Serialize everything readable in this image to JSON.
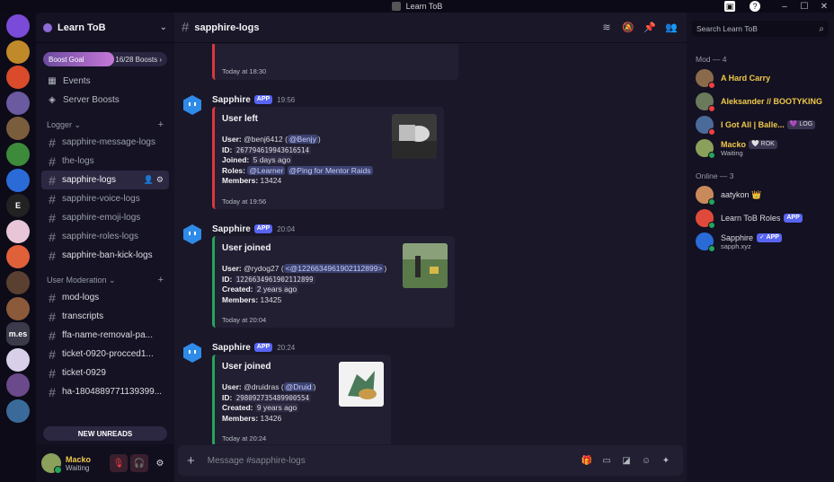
{
  "window": {
    "title": "Learn ToB",
    "controls": [
      "–",
      "☐",
      "✕"
    ]
  },
  "servers": [
    {
      "label": "",
      "color": "#7a4bd8"
    },
    {
      "label": "",
      "color": "#c08a2a"
    },
    {
      "label": "",
      "color": "#d94b2a"
    },
    {
      "label": "",
      "color": "#6b5aa0"
    },
    {
      "label": "",
      "color": "#7a5d3c"
    },
    {
      "label": "",
      "color": "#3d8a3a"
    },
    {
      "label": "",
      "color": "#2a6bd8"
    },
    {
      "label": "E",
      "color": "#222222"
    },
    {
      "label": "",
      "color": "#e8c6d8"
    },
    {
      "label": "",
      "color": "#e0603a"
    },
    {
      "label": "",
      "color": "#5a4030"
    },
    {
      "label": "",
      "color": "#8a5a3a"
    },
    {
      "label": "m.es",
      "color": "#3a3a4a"
    },
    {
      "label": "",
      "color": "#d8d0e8"
    },
    {
      "label": "",
      "color": "#6a4a8a"
    },
    {
      "label": "",
      "color": "#3a6a9a"
    }
  ],
  "guild": {
    "name": "Learn ToB",
    "boost": {
      "goal_label": "Boost Goal",
      "progress_text": "16/28 Boosts",
      "arrow": "›",
      "fraction": 0.571
    }
  },
  "nav": [
    {
      "label": "Events",
      "icon": "calendar-icon",
      "glyph": "▦"
    },
    {
      "label": "Server Boosts",
      "icon": "boost-icon",
      "glyph": "◈"
    }
  ],
  "categories": [
    {
      "name": "Logger",
      "chevron": "⌄",
      "channels": [
        {
          "label": "sapphire-message-logs",
          "state": "normal"
        },
        {
          "label": "the-logs",
          "state": "normal"
        },
        {
          "label": "sapphire-logs",
          "state": "active"
        },
        {
          "label": "sapphire-voice-logs",
          "state": "normal"
        },
        {
          "label": "sapphire-emoji-logs",
          "state": "normal"
        },
        {
          "label": "sapphire-roles-logs",
          "state": "normal"
        },
        {
          "label": "sapphire-ban-kick-logs",
          "state": "bright"
        }
      ]
    },
    {
      "name": "User Moderation",
      "chevron": "⌄",
      "channels": [
        {
          "label": "mod-logs",
          "state": "bright"
        },
        {
          "label": "transcripts",
          "state": "bright"
        },
        {
          "label": "ffa-name-removal-pa...",
          "state": "bright"
        },
        {
          "label": "ticket-0920-procced1...",
          "state": "bright"
        },
        {
          "label": "ticket-0929",
          "state": "bright"
        },
        {
          "label": "ha-1804889771139399...",
          "state": "bright"
        }
      ]
    }
  ],
  "new_unreads": "NEW UNREADS",
  "user": {
    "name": "Macko",
    "status": "Waiting"
  },
  "channel": {
    "name": "sapphire-logs"
  },
  "composer": {
    "placeholder": "Message #sapphire-logs"
  },
  "messages": [
    {
      "footer": "Today at 18:30",
      "partial": true
    },
    {
      "author": "Sapphire",
      "badge": "APP",
      "time": "19:56",
      "color": "#da373c",
      "title": "User left",
      "user_label": "User:",
      "user_value": "@benj6412",
      "user_paren_open": " (",
      "user_mention": "@Benjy",
      "user_paren_close": ")",
      "id_label": "ID:",
      "id_value": "267794619943616514",
      "third_label": "Joined:",
      "third_value": "5 days ago",
      "roles_label": "Roles:",
      "roles": [
        "@Learner",
        "@Ping for Mentor Raids"
      ],
      "members_label": "Members:",
      "members_value": "13424",
      "footer": "Today at 19:56"
    },
    {
      "author": "Sapphire",
      "badge": "APP",
      "time": "20:04",
      "color": "#23a55a",
      "title": "User joined",
      "user_label": "User:",
      "user_value": "@rydog27",
      "user_paren_open": " (",
      "user_mention": "<@1226634961902112899>",
      "user_paren_close": ")",
      "id_label": "ID:",
      "id_value": "1226634961902112899",
      "third_label": "Created:",
      "third_value": "2 years ago",
      "members_label": "Members:",
      "members_value": "13425",
      "footer": "Today at 20:04"
    },
    {
      "author": "Sapphire",
      "badge": "APP",
      "time": "20:24",
      "color": "#23a55a",
      "title": "User joined",
      "user_label": "User:",
      "user_value": "@druidras",
      "user_paren_open": " (",
      "user_mention": "@Druid",
      "user_paren_close": ")",
      "id_label": "ID:",
      "id_value": "298092735489900554",
      "third_label": "Created:",
      "third_value": "9 years ago",
      "members_label": "Members:",
      "members_value": "13426",
      "footer": "Today at 20:24"
    }
  ],
  "search": {
    "placeholder": "Search Learn ToB"
  },
  "member_groups": [
    {
      "title": "Mod — 4",
      "members": [
        {
          "name": "A Hard Carry",
          "color": "#f0c949",
          "avatar": "#8a6a4a",
          "status": "dnd"
        },
        {
          "name": "Aleksander // BOOTYKING",
          "color": "#f0c949",
          "avatar": "#6a7a5a",
          "status": "dnd"
        },
        {
          "name": "I Got All | Balle...",
          "color": "#f0c949",
          "avatar": "#4a6a9a",
          "status": "dnd",
          "tag": "💜 LOG"
        },
        {
          "name": "Macko",
          "color": "#f0c949",
          "avatar": "#8ba05a",
          "status": "online",
          "tag": "🤍 ROK",
          "sub": "Waiting"
        }
      ]
    },
    {
      "title": "Online — 3",
      "members": [
        {
          "name": "aatykon 👑",
          "color": "#dbdee1",
          "avatar": "#c88a5a",
          "status": "online"
        },
        {
          "name": "Learn ToB Roles",
          "color": "#dbdee1",
          "avatar": "#e04a3a",
          "status": "online",
          "badge": "APP"
        },
        {
          "name": "Sapphire",
          "color": "#dbdee1",
          "avatar": "#2a6bd8",
          "status": "online",
          "badge": "✓ APP",
          "sub": "sapph.xyz"
        }
      ]
    }
  ]
}
